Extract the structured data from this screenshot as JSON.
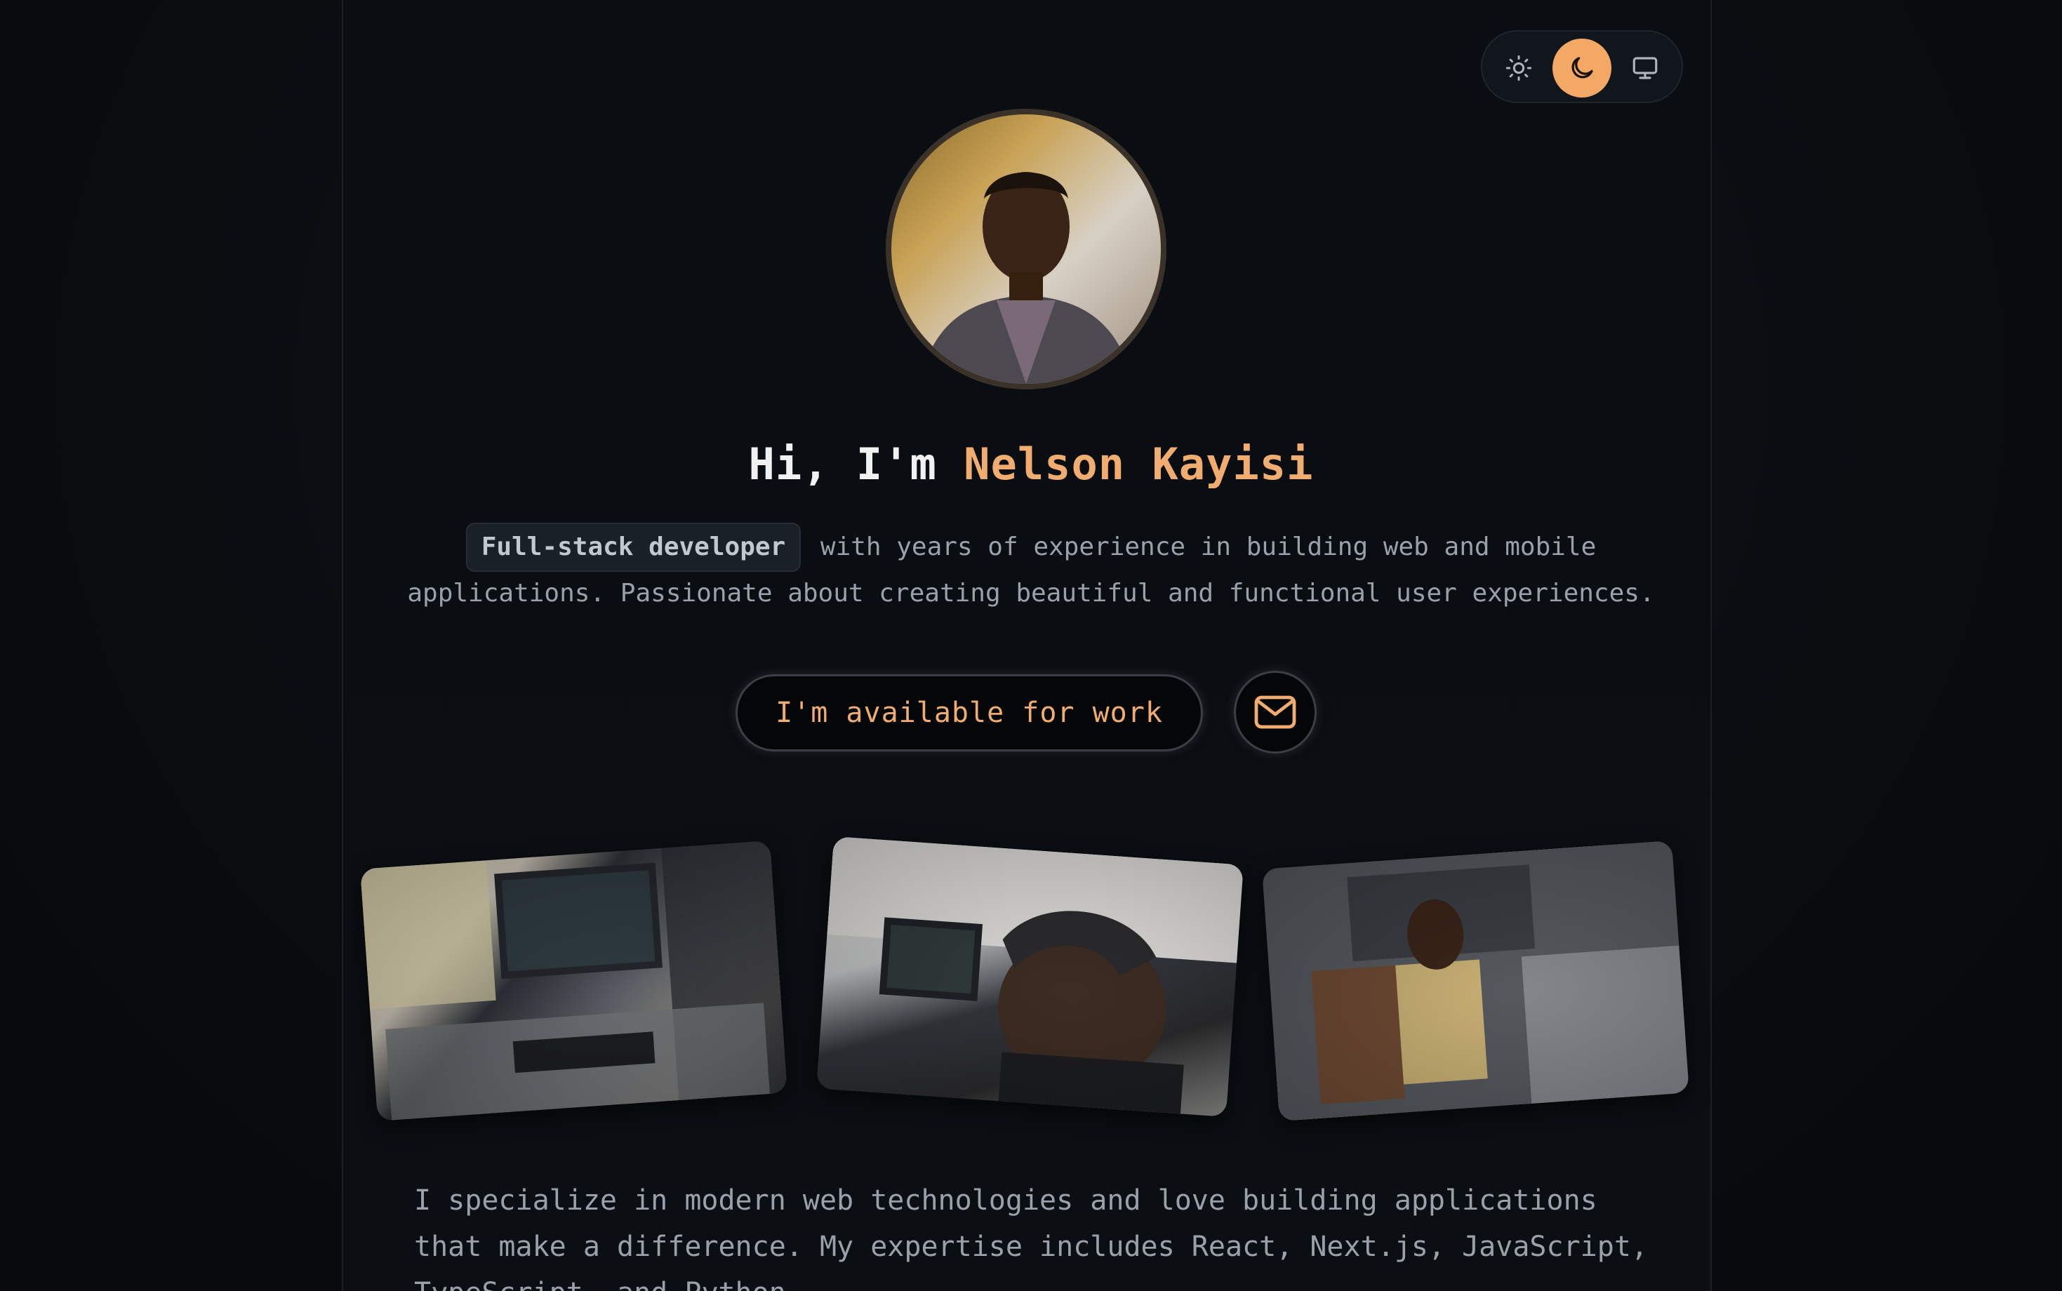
{
  "theme_switcher": {
    "options": [
      {
        "name": "light",
        "icon": "sun-icon",
        "active": false
      },
      {
        "name": "dark",
        "icon": "moon-icon",
        "active": true
      },
      {
        "name": "system",
        "icon": "monitor-icon",
        "active": false
      }
    ],
    "accent_color": "#f3a865"
  },
  "hero": {
    "greeting_prefix": "Hi, I'm ",
    "name": "Nelson Kayisi",
    "role_badge": "Full-stack developer",
    "intro_rest": " with years of experience in building web and mobile applications. Passionate about creating beautiful and functional user experiences."
  },
  "cta": {
    "available_label": "I'm available for work",
    "mail_icon": "mail-icon"
  },
  "bio": {
    "text": "I specialize in modern web technologies and love building applications that make a difference. My expertise includes React, Next.js, JavaScript, TypeScript, and Python."
  },
  "colors": {
    "accent": "#f1ad70",
    "background": "#0b0e12",
    "muted_text": "#9aa1ab"
  }
}
